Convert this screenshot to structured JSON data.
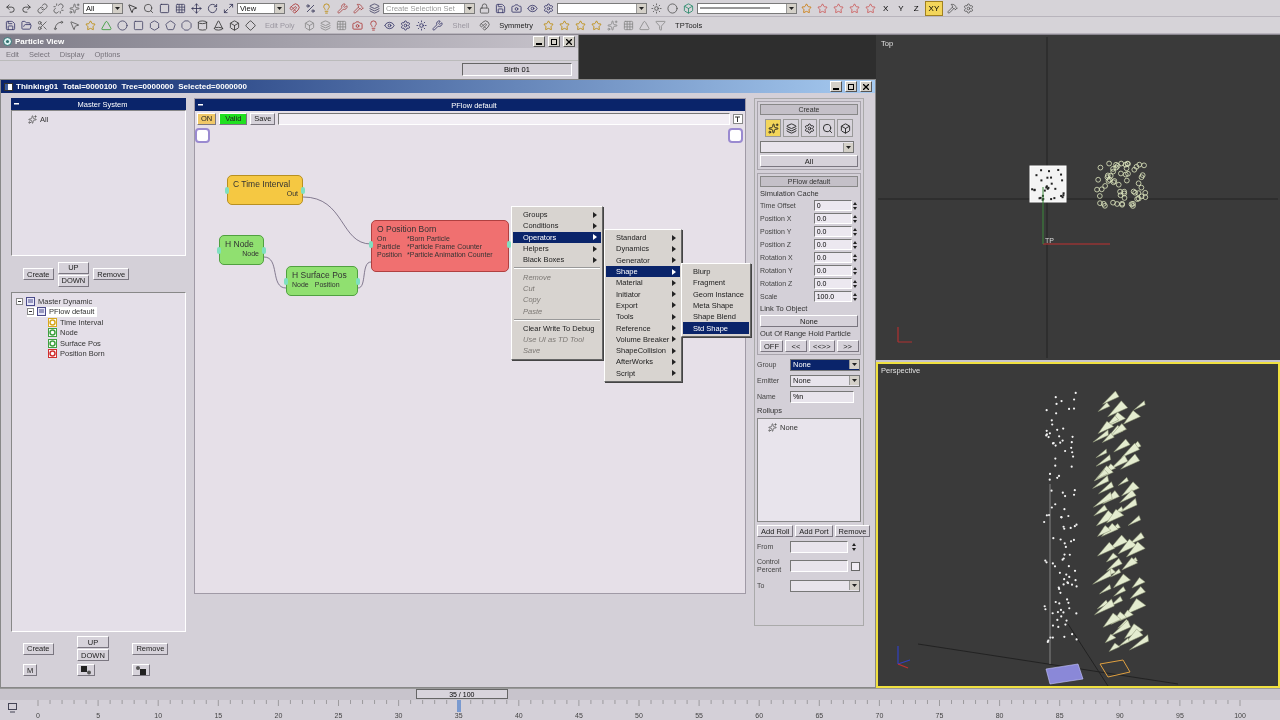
{
  "toolbar": {
    "selection_filter": "All",
    "reference_coord": "View",
    "selection_set_placeholder": "Create Selection Set",
    "axes": [
      {
        "label": "X",
        "selected": false
      },
      {
        "label": "Y",
        "selected": false
      },
      {
        "label": "Z",
        "selected": false
      },
      {
        "label": "XY",
        "selected": true
      }
    ],
    "row_2_labels": [
      {
        "label": "Edit Poly",
        "disabled": true
      },
      {
        "label": "Shell",
        "disabled": true
      },
      {
        "label": "Symmetry",
        "disabled": false
      },
      {
        "label": "TPTools",
        "disabled": false
      }
    ]
  },
  "particle_view": {
    "title": "Particle View",
    "menu": [
      {
        "label": "Edit",
        "disabled": true
      },
      {
        "label": "Select",
        "disabled": true
      },
      {
        "label": "Display",
        "disabled": true
      },
      {
        "label": "Options",
        "disabled": true
      }
    ],
    "event_field": "Birth 01"
  },
  "event_window": {
    "title": "Thinking01  Total=0000100  Tree=0000000  Selected=0000000"
  },
  "master_system": {
    "title": "Master System",
    "items": [
      {
        "label": "All"
      }
    ],
    "buttons": {
      "create": "Create",
      "up": "UP",
      "down": "DOWN",
      "remove": "Remove"
    }
  },
  "tree": [
    {
      "label": "Master Dynamic",
      "expanded": true,
      "selected": false,
      "children": [
        {
          "label": "PFlow default",
          "expanded": true,
          "selected": true,
          "children": [
            {
              "label": "Time Interval",
              "color": "#d8a820",
              "selected": false
            },
            {
              "label": "Node",
              "color": "#40a040",
              "selected": false
            },
            {
              "label": "Surface Pos",
              "color": "#40a040",
              "selected": false
            },
            {
              "label": "Position Born",
              "color": "#d03030",
              "selected": false
            }
          ]
        }
      ]
    }
  ],
  "tree_buttons": {
    "create": "Create",
    "up": "UP",
    "down": "DOWN",
    "remove": "Remove",
    "m": "M"
  },
  "editor": {
    "title": "PFlow default",
    "on_label": "ON",
    "on": true,
    "status": "Valid",
    "save_label": "Save",
    "nodes": [
      {
        "kind": "condition",
        "title": "C Time Interval",
        "ports": [
          [
            "Out"
          ]
        ]
      },
      {
        "kind": "helper",
        "title": "H Node",
        "ports": [
          [
            "Node"
          ]
        ]
      },
      {
        "kind": "helper",
        "title": "H Surface Pos",
        "ports": [
          [
            "Node",
            "Position"
          ]
        ]
      },
      {
        "kind": "operator",
        "title": "O Position Born",
        "ports": [
          [
            "On",
            "*Born Particle"
          ],
          [
            "Particle",
            "*Particle Frame Counter"
          ],
          [
            "Position",
            "*Particle Animation Counter"
          ]
        ]
      }
    ],
    "context_menu": [
      {
        "kind": "item",
        "label": "Groups",
        "submenu": true,
        "selected": false,
        "disabled": false
      },
      {
        "kind": "item",
        "label": "Conditions",
        "submenu": true,
        "selected": false,
        "disabled": false
      },
      {
        "kind": "item",
        "label": "Operators",
        "submenu": true,
        "selected": true,
        "disabled": false
      },
      {
        "kind": "item",
        "label": "Helpers",
        "submenu": true,
        "selected": false,
        "disabled": false
      },
      {
        "kind": "item",
        "label": "Black Boxes",
        "submenu": true,
        "selected": false,
        "disabled": false
      },
      {
        "kind": "separator"
      },
      {
        "kind": "item",
        "label": "Remove",
        "submenu": false,
        "selected": false,
        "disabled": true
      },
      {
        "kind": "item",
        "label": "Cut",
        "submenu": false,
        "selected": false,
        "disabled": true
      },
      {
        "kind": "item",
        "label": "Copy",
        "submenu": false,
        "selected": false,
        "disabled": true
      },
      {
        "kind": "item",
        "label": "Paste",
        "submenu": false,
        "selected": false,
        "disabled": true
      },
      {
        "kind": "separator"
      },
      {
        "kind": "item",
        "label": "Clear Write To Debug",
        "submenu": false,
        "selected": false,
        "disabled": false
      },
      {
        "kind": "item",
        "label": "Use UI as TD Tool",
        "submenu": false,
        "selected": false,
        "disabled": true
      },
      {
        "kind": "item",
        "label": "Save",
        "submenu": false,
        "selected": false,
        "disabled": true
      }
    ],
    "operators_menu": [
      {
        "kind": "item",
        "label": "Standard",
        "submenu": true,
        "selected": false,
        "disabled": false
      },
      {
        "kind": "item",
        "label": "Dynamics",
        "submenu": true,
        "selected": false,
        "disabled": false
      },
      {
        "kind": "item",
        "label": "Generator",
        "submenu": true,
        "selected": false,
        "disabled": false
      },
      {
        "kind": "item",
        "label": "Shape",
        "submenu": true,
        "selected": true,
        "disabled": false
      },
      {
        "kind": "item",
        "label": "Material",
        "submenu": true,
        "selected": false,
        "disabled": false
      },
      {
        "kind": "item",
        "label": "Initiator",
        "submenu": true,
        "selected": false,
        "disabled": false
      },
      {
        "kind": "item",
        "label": "Export",
        "submenu": true,
        "selected": false,
        "disabled": false
      },
      {
        "kind": "item",
        "label": "Tools",
        "submenu": true,
        "selected": false,
        "disabled": false
      },
      {
        "kind": "item",
        "label": "Reference",
        "submenu": true,
        "selected": false,
        "disabled": false
      },
      {
        "kind": "item",
        "label": "Volume Breaker",
        "submenu": true,
        "selected": false,
        "disabled": false
      },
      {
        "kind": "item",
        "label": "ShapeCollision",
        "submenu": true,
        "selected": false,
        "disabled": false
      },
      {
        "kind": "item",
        "label": "AfterWorks",
        "submenu": true,
        "selected": false,
        "disabled": false
      },
      {
        "kind": "item",
        "label": "Script",
        "submenu": true,
        "selected": false,
        "disabled": false
      }
    ],
    "shape_menu": [
      {
        "kind": "item",
        "label": "Blurp",
        "submenu": false,
        "selected": false,
        "disabled": false
      },
      {
        "kind": "item",
        "label": "Fragment",
        "submenu": false,
        "selected": false,
        "disabled": false
      },
      {
        "kind": "item",
        "label": "Geom Instance",
        "submenu": false,
        "selected": false,
        "disabled": false
      },
      {
        "kind": "item",
        "label": "Meta Shape",
        "submenu": false,
        "selected": false,
        "disabled": false
      },
      {
        "kind": "item",
        "label": "Shape Blend",
        "submenu": false,
        "selected": false,
        "disabled": false
      },
      {
        "kind": "item",
        "label": "Std Shape",
        "submenu": false,
        "selected": true,
        "disabled": false
      }
    ]
  },
  "properties": {
    "create_title": "Create",
    "tools": [
      {
        "selected": true
      },
      {
        "selected": false
      },
      {
        "selected": false
      },
      {
        "selected": false
      },
      {
        "selected": false
      }
    ],
    "all_button": "All",
    "rollout_title": "PFlow default",
    "group_title": "Simulation Cache",
    "params": [
      {
        "label": "Time Offset",
        "value": "0"
      },
      {
        "label": "Position X",
        "value": "0.0"
      },
      {
        "label": "Position Y",
        "value": "0.0"
      },
      {
        "label": "Position Z",
        "value": "0.0"
      },
      {
        "label": "Rotation X",
        "value": "0.0"
      },
      {
        "label": "Rotation Y",
        "value": "0.0"
      },
      {
        "label": "Rotation Z",
        "value": "0.0"
      },
      {
        "label": "Scale",
        "value": "100.0"
      }
    ],
    "link_label": "Link To Object",
    "link_button": "None",
    "range_label": "Out Of Range Hold Particle",
    "range_buttons": [
      "OFF",
      "<<",
      "<<>>",
      ">>"
    ],
    "group": {
      "label": "Group",
      "value": "None",
      "focused": true
    },
    "emitter": {
      "label": "Emitter",
      "value": "None",
      "focused": false
    },
    "name": {
      "label": "Name",
      "value": "%n"
    },
    "rollups_label": "Rollups",
    "rollups": [
      "None"
    ],
    "roll_buttons": [
      "Add Roll",
      "Add Port",
      "Remove"
    ],
    "from_label": "From",
    "control_label": "Control Percent",
    "control_checked": false,
    "to_label": "To"
  },
  "viewports": [
    {
      "label": "Top",
      "active": false
    },
    {
      "label": "Perspective",
      "active": true
    }
  ],
  "viewport_marker": "TP",
  "timeline": {
    "reading": "35 / 100",
    "level": 0.35,
    "ruler_labels": [
      "0",
      "5",
      "10",
      "15",
      "20",
      "25",
      "30",
      "35",
      "40",
      "45",
      "50",
      "55",
      "60",
      "65",
      "70",
      "75",
      "80",
      "85",
      "90",
      "95",
      "100"
    ]
  }
}
